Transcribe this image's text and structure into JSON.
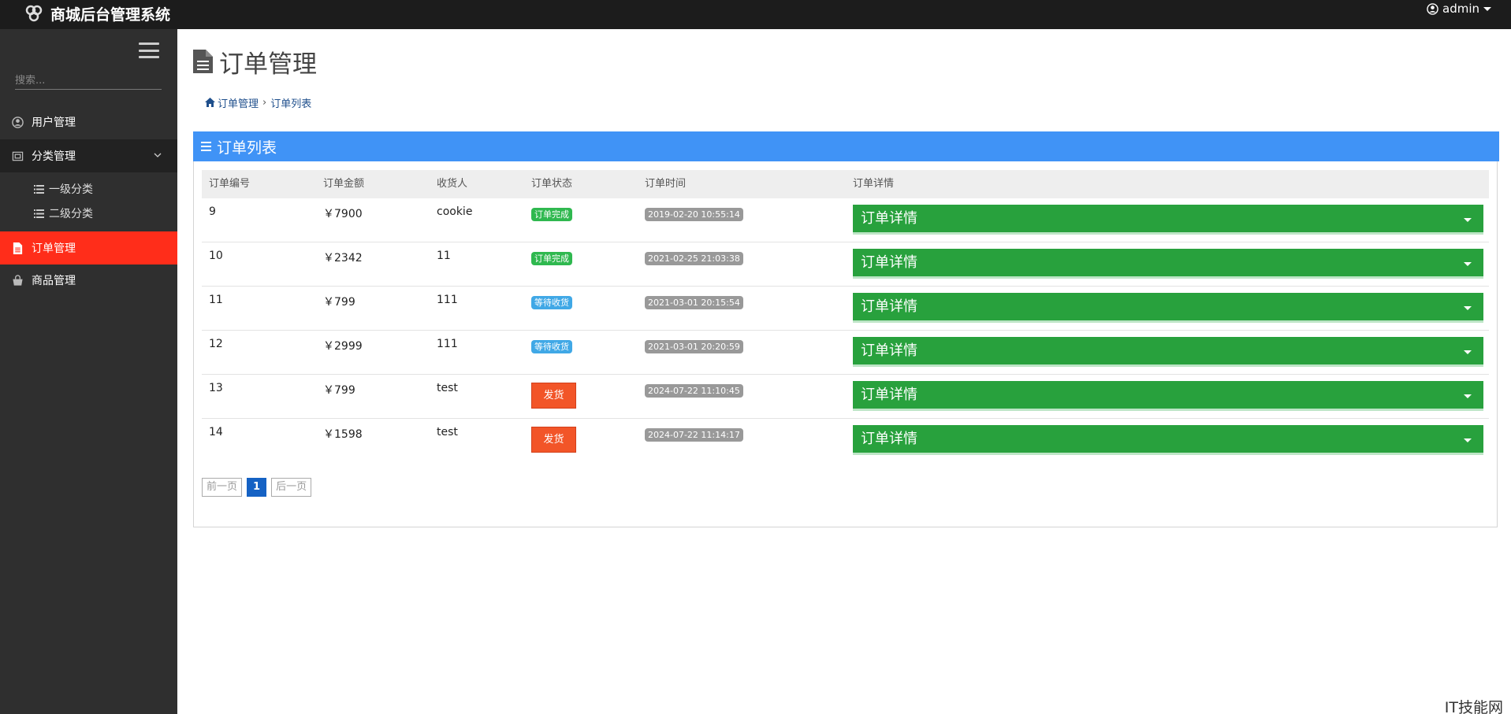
{
  "app": {
    "title": "商城后台管理系统",
    "user": "admin",
    "watermark": "IT技能网"
  },
  "sidebar": {
    "search_placeholder": "搜索...",
    "items": [
      {
        "label": "用户管理",
        "icon": "user-circle-icon"
      },
      {
        "label": "分类管理",
        "icon": "category-icon",
        "expanded": true,
        "children": [
          {
            "label": "一级分类",
            "icon": "list-icon"
          },
          {
            "label": "二级分类",
            "icon": "list-icon"
          }
        ]
      },
      {
        "label": "订单管理",
        "icon": "file-icon",
        "active": true
      },
      {
        "label": "商品管理",
        "icon": "bag-icon"
      }
    ]
  },
  "page": {
    "title": "订单管理",
    "breadcrumb": [
      "订单管理",
      "订单列表"
    ]
  },
  "panel": {
    "title": "订单列表",
    "columns": [
      "订单编号",
      "订单金额",
      "收货人",
      "订单状态",
      "订单时间",
      "订单详情"
    ],
    "rows": [
      {
        "id": "9",
        "amount": "￥7900",
        "receiver": "cookie",
        "status": "订单完成",
        "status_type": "done",
        "time": "2019-02-20 10:55:14",
        "detail": "订单详情"
      },
      {
        "id": "10",
        "amount": "￥2342",
        "receiver": "11",
        "status": "订单完成",
        "status_type": "done",
        "time": "2021-02-25 21:03:38",
        "detail": "订单详情"
      },
      {
        "id": "11",
        "amount": "￥799",
        "receiver": "111",
        "status": "等待收货",
        "status_type": "wait",
        "time": "2021-03-01 20:15:54",
        "detail": "订单详情"
      },
      {
        "id": "12",
        "amount": "￥2999",
        "receiver": "111",
        "status": "等待收货",
        "status_type": "wait",
        "time": "2021-03-01 20:20:59",
        "detail": "订单详情"
      },
      {
        "id": "13",
        "amount": "￥799",
        "receiver": "test",
        "status": "发货",
        "status_type": "ship",
        "time": "2024-07-22 11:10:45",
        "detail": "订单详情"
      },
      {
        "id": "14",
        "amount": "￥1598",
        "receiver": "test",
        "status": "发货",
        "status_type": "ship",
        "time": "2024-07-22 11:14:17",
        "detail": "订单详情"
      }
    ],
    "pager": {
      "prev": "前一页",
      "current": "1",
      "next": "后一页"
    }
  },
  "colors": {
    "topbar": "#1c1c1c",
    "sidebar": "#2f2f2f",
    "active_nav": "#ff2d1a",
    "panel_head": "#4093f6",
    "detail_button": "#28a13d",
    "ship_button": "#f25528"
  }
}
